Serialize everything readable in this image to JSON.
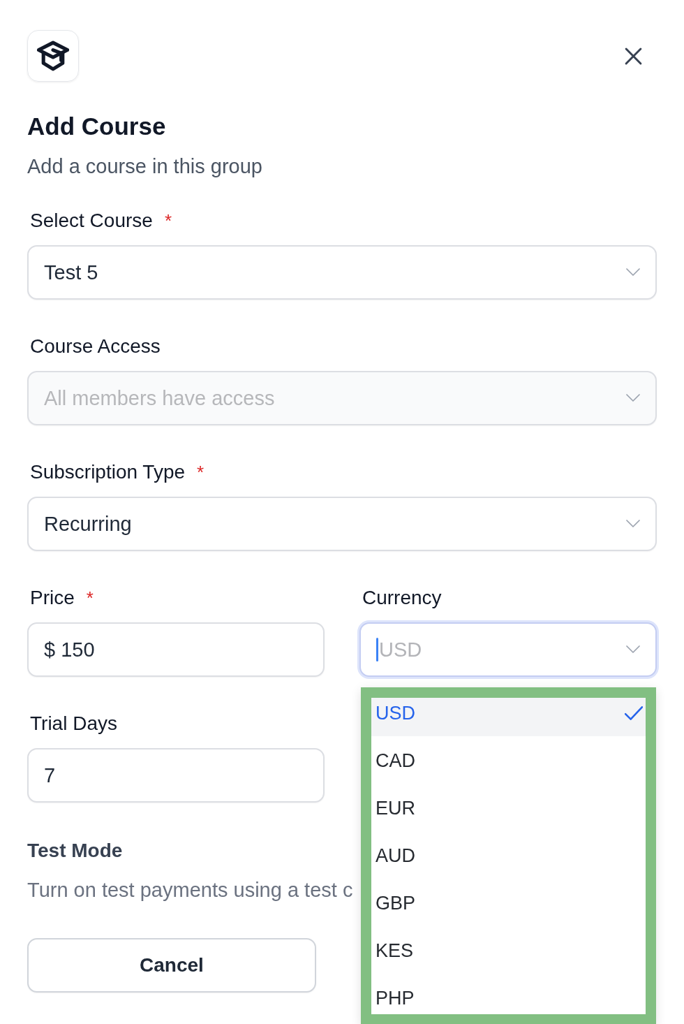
{
  "header": {
    "title": "Add Course",
    "subtitle": "Add a course in this group"
  },
  "course_fields": [
    {
      "kind": "select",
      "label": "Select Course",
      "required_mark": "*",
      "value": "Test 5",
      "disabled": false
    },
    {
      "kind": "select",
      "label": "Course Access",
      "value": "All members have access",
      "disabled": true
    },
    {
      "kind": "select",
      "label": "Subscription Type",
      "required_mark": "*",
      "value": "Recurring",
      "disabled": false
    }
  ],
  "pricing_fields": [
    {
      "kind": "input",
      "label": "Price",
      "required_mark": "*",
      "value": "$ 150"
    },
    {
      "kind": "combobox",
      "label": "Currency",
      "placeholder": "USD",
      "focused": true,
      "expanded": true,
      "options": [
        {
          "label": "USD",
          "selected": true
        },
        {
          "label": "CAD",
          "selected": false
        },
        {
          "label": "EUR",
          "selected": false
        },
        {
          "label": "AUD",
          "selected": false
        },
        {
          "label": "GBP",
          "selected": false
        },
        {
          "label": "KES",
          "selected": false
        },
        {
          "label": "PHP",
          "selected": false
        }
      ]
    },
    {
      "kind": "input",
      "label": "Trial Days",
      "value": "7"
    }
  ],
  "test_mode": {
    "title": "Test Mode",
    "description": "Turn on test payments using a test c"
  },
  "buttons": [
    {
      "label": "Cancel"
    }
  ]
}
